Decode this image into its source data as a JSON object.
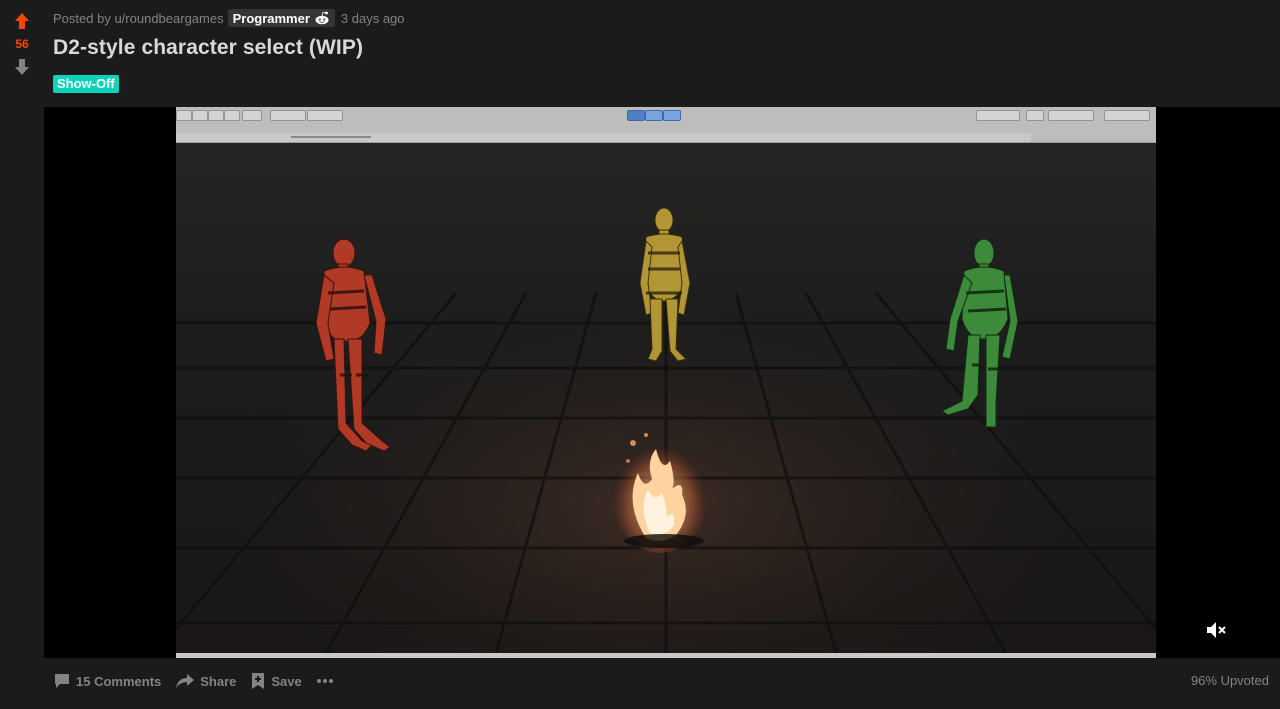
{
  "post": {
    "score": "56",
    "meta": {
      "prefix": "Posted by",
      "author": "u/roundbeargames",
      "user_flair": "Programmer",
      "time": "3 days ago"
    },
    "title": "D2-style character select (WIP)",
    "flair": "Show-Off",
    "footer": {
      "comments": "15 Comments",
      "share": "Share",
      "save": "Save",
      "upvoted": "96% Upvoted"
    }
  },
  "colors": {
    "upvote": "#ff4500",
    "flair": "#0dd3bb",
    "background": "#1b1b1c",
    "muted_text": "#818384"
  },
  "icons": {
    "upvote": "arrow-up-icon",
    "downvote": "arrow-down-icon",
    "flair_emoji": "snoo-icon",
    "mute": "speaker-muted-icon",
    "comments": "comment-icon",
    "share": "share-icon",
    "save": "bookmark-icon",
    "more": "more-icon"
  }
}
